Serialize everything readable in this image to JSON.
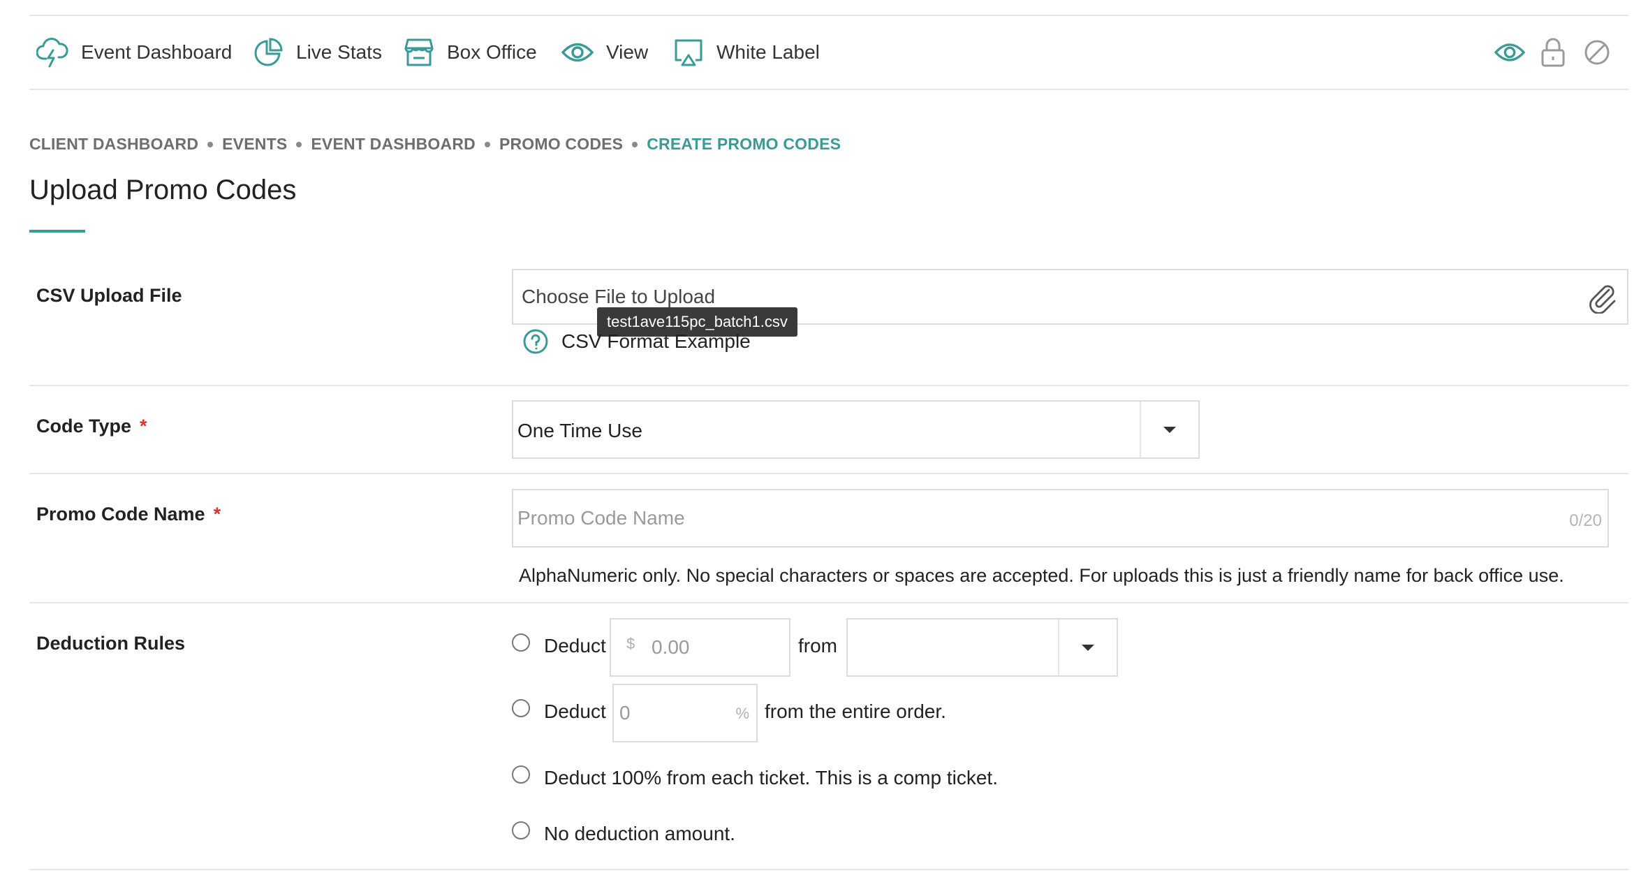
{
  "nav": {
    "items": [
      {
        "label": "Event Dashboard",
        "icon": "lightning-cloud-icon"
      },
      {
        "label": "Live Stats",
        "icon": "pie-chart-icon"
      },
      {
        "label": "Box Office",
        "icon": "box-office-icon"
      },
      {
        "label": "View",
        "icon": "eye-icon"
      },
      {
        "label": "White Label",
        "icon": "cast-screen-icon"
      }
    ],
    "right_icons": [
      "eye-icon",
      "lock-icon",
      "block-icon"
    ]
  },
  "breadcrumb": {
    "items": [
      "CLIENT DASHBOARD",
      "EVENTS",
      "EVENT DASHBOARD",
      "PROMO CODES"
    ],
    "current": "CREATE PROMO CODES"
  },
  "page": {
    "title": "Upload Promo Codes"
  },
  "csv_upload": {
    "label": "CSV Upload File",
    "placeholder": "Choose File to Upload",
    "tooltip": "test1ave115pc_batch1.csv",
    "help_link": "CSV Format Example"
  },
  "code_type": {
    "label": "Code Type",
    "required_mark": "*",
    "value": "One Time Use"
  },
  "promo_name": {
    "label": "Promo Code Name",
    "required_mark": "*",
    "placeholder": "Promo Code Name",
    "counter": "0/20",
    "help": "AlphaNumeric only. No special characters or spaces are accepted. For uploads this is just a friendly name for back office use."
  },
  "deduction": {
    "label": "Deduction Rules",
    "option1": {
      "prefix": "Deduct",
      "currency": "$",
      "placeholder": "0.00",
      "from": "from"
    },
    "option2": {
      "prefix": "Deduct",
      "placeholder": "0",
      "unit": "%",
      "suffix": "from the entire order."
    },
    "option3": {
      "text": "Deduct 100% from each ticket. This is a comp ticket."
    },
    "option4": {
      "text": "No deduction amount."
    }
  },
  "colors": {
    "accent": "#3a9a96",
    "required": "#d9342b",
    "tooltip_bg": "#3a3a3a"
  }
}
